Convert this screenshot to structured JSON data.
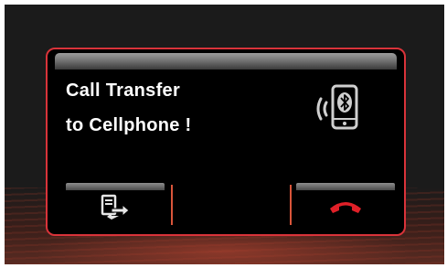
{
  "dialog": {
    "line1": "Call Transfer",
    "line2": "to Cellphone !"
  },
  "icons": {
    "status": "bluetooth-phone-icon",
    "transfer": "call-transfer-icon",
    "hangup": "hang-up-icon"
  },
  "colors": {
    "border": "#d9333a",
    "hangup": "#e02028",
    "background": "#1b1b1b"
  }
}
